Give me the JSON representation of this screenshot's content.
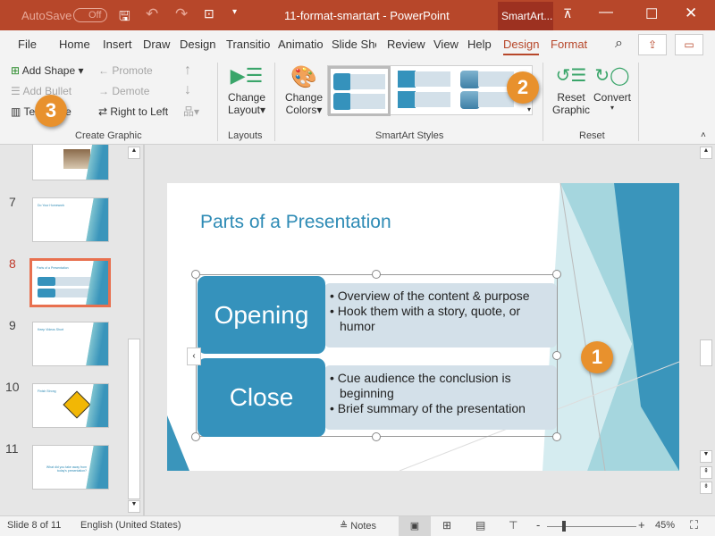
{
  "titlebar": {
    "autosave": "AutoSave",
    "autosave_state": "Off",
    "doc_title": "11-format-smartart  -  PowerPoint",
    "context_tab": "SmartArt..."
  },
  "tabs": [
    "File",
    "Home",
    "Insert",
    "Draw",
    "Design",
    "Transitio",
    "Animatio",
    "Slide Sho",
    "Review",
    "View",
    "Help",
    "Design",
    "Format"
  ],
  "active_tab": "Design",
  "ribbon": {
    "create_graphic": {
      "add_shape": "Add Shape",
      "promote": "Promote",
      "add_bullet": "Add Bullet",
      "demote": "Demote",
      "text_pane": "Text Pane",
      "right_to_left": "Right to Left",
      "label": "Create Graphic"
    },
    "layouts": {
      "change_layout_1": "Change",
      "change_layout_2": "Layout",
      "label": "Layouts"
    },
    "styles": {
      "change_colors_1": "Change",
      "change_colors_2": "Colors",
      "label": "SmartArt Styles"
    },
    "reset": {
      "reset_1": "Reset",
      "reset_2": "Graphic",
      "convert": "Convert",
      "label": "Reset"
    }
  },
  "thumbnails": [
    {
      "num": "",
      "title": ""
    },
    {
      "num": "7",
      "title": "Do Your Homework"
    },
    {
      "num": "8",
      "title": "Parts of a Presentation",
      "selected": true
    },
    {
      "num": "9",
      "title": "Keep Videos Short"
    },
    {
      "num": "10",
      "title": "Finish Strong"
    },
    {
      "num": "11",
      "title": "What did you take away from today's presentation?"
    }
  ],
  "slide": {
    "title": "Parts of a Presentation",
    "items": [
      {
        "label": "Opening",
        "bullets": [
          "Overview of the content & purpose",
          "Hook them with a story, quote, or humor"
        ]
      },
      {
        "label": "Close",
        "bullets": [
          "Cue audience the conclusion is beginning",
          "Brief summary of the presentation"
        ]
      }
    ]
  },
  "callouts": [
    "1",
    "2",
    "3"
  ],
  "status": {
    "slide": "Slide 8 of 11",
    "language": "English (United States)",
    "notes": "Notes",
    "zoom": "45%",
    "zoom_level_percent": 45
  },
  "colors": {
    "accent": "#b7472a",
    "smartart_blue": "#3592bc",
    "callout": "#e8912d",
    "title_blue": "#2e8bb5"
  }
}
